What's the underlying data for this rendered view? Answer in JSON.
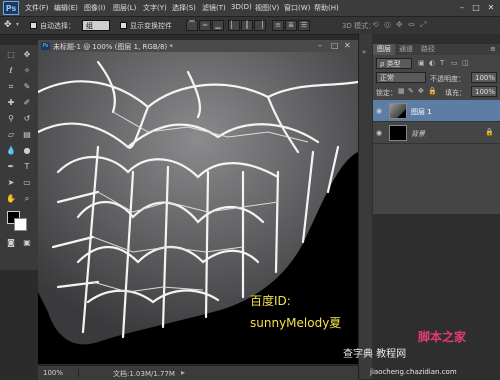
{
  "app": {
    "logo": "Ps"
  },
  "menu": [
    "文件(F)",
    "编辑(E)",
    "图像(I)",
    "图层(L)",
    "文字(Y)",
    "选择(S)",
    "滤镜(T)",
    "3D(D)",
    "视图(V)",
    "窗口(W)",
    "帮助(H)"
  ],
  "window_buttons": [
    "–",
    "□",
    "✕"
  ],
  "options": {
    "auto_select_label": "自动选择：",
    "auto_select_value": "组",
    "show_transform_label": "显示变换控件",
    "mode_label": "3D 模式："
  },
  "document": {
    "tab_title": "未标题-1 @ 100% (图层 1, RGB/8) *",
    "zoom": "100%",
    "doc_info": "文档:1.03M/1.77M"
  },
  "panel": {
    "tabs": [
      "图层",
      "通道",
      "路径"
    ],
    "kind_label": "ρ 类型",
    "blend_mode": "正常",
    "opacity_label": "不透明度：",
    "opacity_value": "100%",
    "lock_label": "锁定：",
    "fill_label": "填充：",
    "fill_value": "100%",
    "layers": [
      {
        "name": "图层 1"
      },
      {
        "name": "背景"
      }
    ]
  },
  "overlay": {
    "baidu_line1": "百度ID:",
    "baidu_line2": "sunnyMelody夏",
    "logo_text": "查字典 教程网",
    "url": "jiaocheng.chazidian.com",
    "jiaoben": "脚本之家"
  }
}
